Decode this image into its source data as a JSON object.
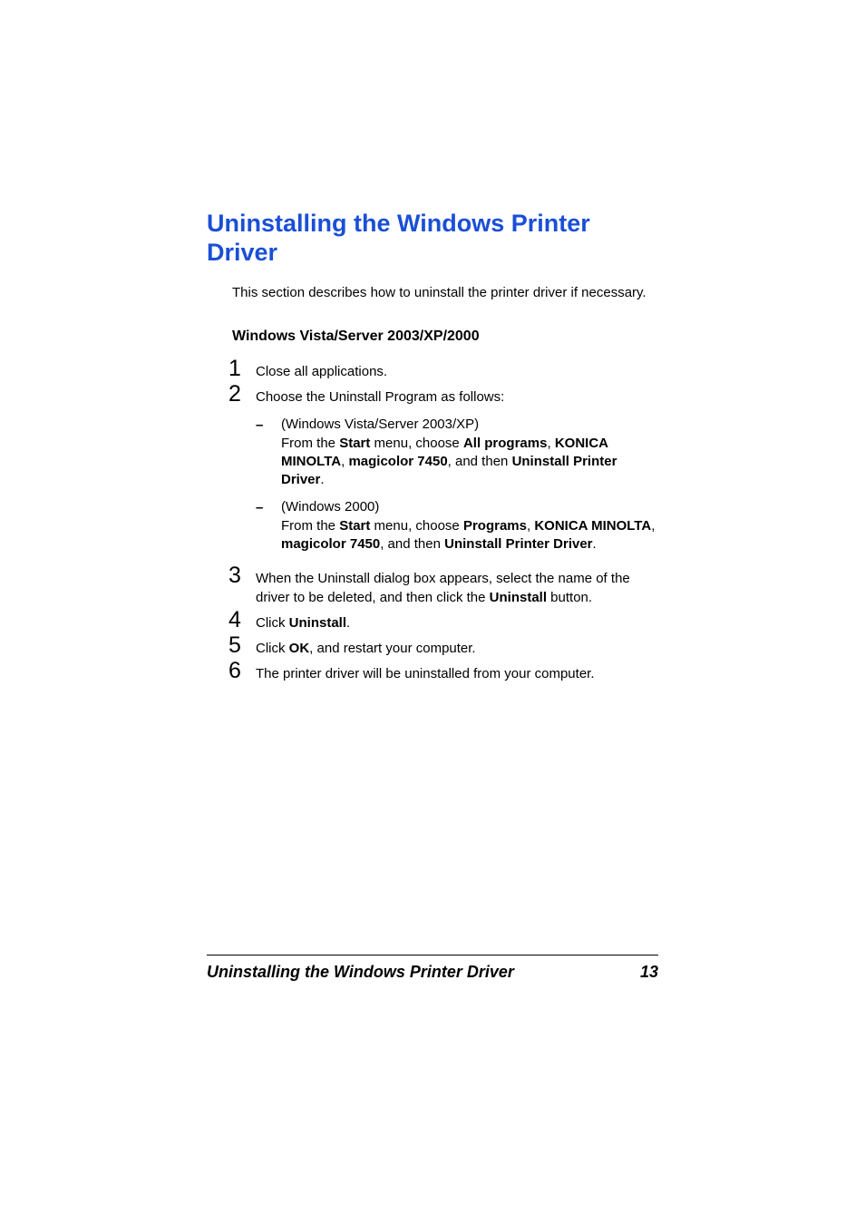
{
  "title": "Uninstalling the Windows Printer Driver",
  "intro": "This section describes how to uninstall the printer driver if necessary.",
  "subhead": "Windows Vista/Server 2003/XP/2000",
  "steps": {
    "s1": {
      "num": "1",
      "text": "Close all applications."
    },
    "s2": {
      "num": "2",
      "text": "Choose the Uninstall Program as follows:",
      "sub1": {
        "line1": "(Windows Vista/Server 2003/XP)",
        "line2a": "From the ",
        "line2b": "Start",
        "line2c": " menu, choose ",
        "line2d": "All programs",
        "line2e": ", ",
        "line2f": "KONICA MINOLTA",
        "line2g": ", ",
        "line2h": "magicolor 7450",
        "line2i": ", and then ",
        "line2j": "Uninstall Printer Driver",
        "line2k": "."
      },
      "sub2": {
        "line1": "(Windows 2000)",
        "line2a": "From the ",
        "line2b": "Start",
        "line2c": " menu, choose ",
        "line2d": "Programs",
        "line2e": ", ",
        "line2f": "KONICA MINOLTA",
        "line2g": ", ",
        "line2h": "magicolor 7450",
        "line2i": ", and then ",
        "line2j": "Uninstall Printer Driver",
        "line2k": "."
      }
    },
    "s3": {
      "num": "3",
      "a": "When the Uninstall dialog box appears, select the name of the driver to be deleted, and then click the ",
      "b": "Uninstall",
      "c": " button."
    },
    "s4": {
      "num": "4",
      "a": "Click ",
      "b": "Uninstall",
      "c": "."
    },
    "s5": {
      "num": "5",
      "a": "Click ",
      "b": "OK",
      "c": ", and restart your computer."
    },
    "s6": {
      "num": "6",
      "text": "The printer driver will be uninstalled from your computer."
    }
  },
  "footer": {
    "title": "Uninstalling the Windows Printer Driver",
    "page": "13"
  }
}
